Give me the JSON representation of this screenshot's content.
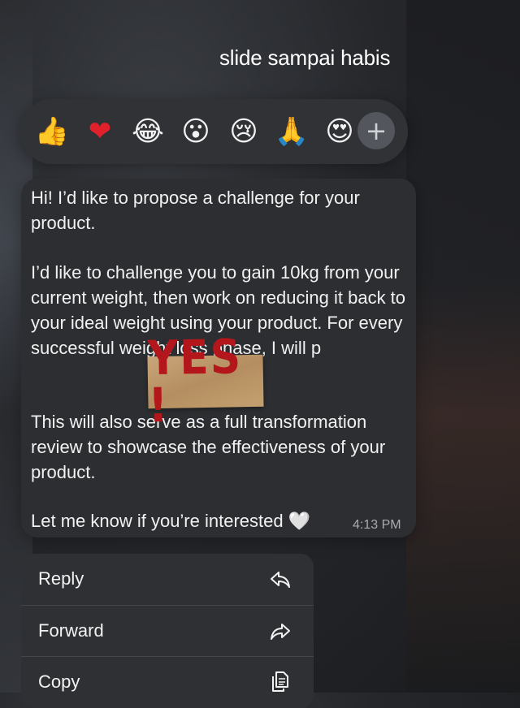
{
  "overlay": {
    "caption": "slide sampai habis"
  },
  "reactions": {
    "items": [
      {
        "name": "thumbs-up",
        "glyph": "👍",
        "color": "#f6c343"
      },
      {
        "name": "red-heart",
        "glyph": "❤",
        "color": "#e0212b"
      },
      {
        "name": "tears-of-joy",
        "glyph": "😂",
        "color": "#f6c343"
      },
      {
        "name": "surprised",
        "glyph": "😮",
        "color": "#f6c343"
      },
      {
        "name": "crying",
        "glyph": "😢",
        "color": "#f6c343"
      },
      {
        "name": "praying-hands",
        "glyph": "🙏",
        "color": "#f6c343"
      },
      {
        "name": "heart-eyes",
        "glyph": "😍",
        "color": "#f6c343"
      }
    ],
    "more_glyph": "+"
  },
  "message": {
    "para1": "Hi! I’d like to propose a challenge for your product.",
    "para2": "I’d like to challenge you to gain 10kg from your current weight, then work on reducing it back to your ideal weight using your product. For every successful weight loss phase, I will p",
    "para3": "This will also serve as a full transformation review to showcase the effectiveness of your product.",
    "para4": "Let me know if you’re interested",
    "heart": "🤍",
    "time": "4:13 PM"
  },
  "sticker": {
    "text": "YES !"
  },
  "context_menu": {
    "reply": "Reply",
    "forward": "Forward",
    "copy": "Copy"
  },
  "colors": {
    "bubble": "#2d2e31",
    "menu": "#2f3034",
    "sticker_text": "#b3171c"
  }
}
